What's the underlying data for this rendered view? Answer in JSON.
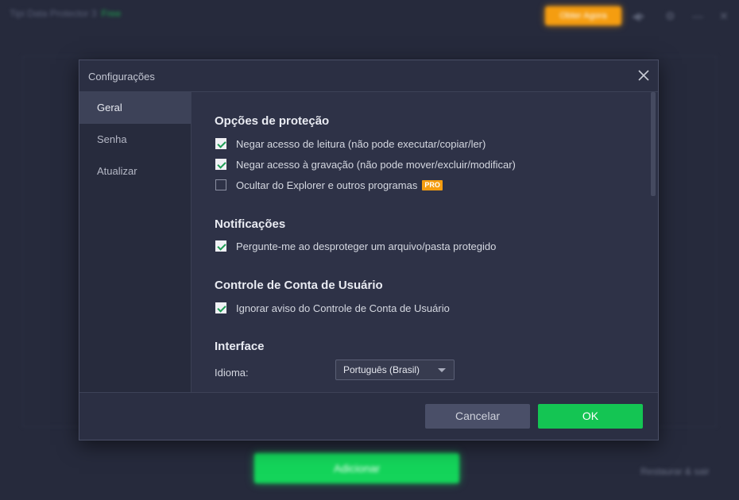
{
  "background_app": {
    "title": "Tipi Data Protector 3",
    "edition": "Free",
    "upgrade_label": "Obter Agora",
    "add_label": "Adicionar",
    "restore_label": "Restaurar & sair"
  },
  "dialog": {
    "title": "Configurações",
    "close_icon": "close-icon"
  },
  "sidebar": {
    "items": [
      {
        "label": "Geral",
        "active": true
      },
      {
        "label": "Senha",
        "active": false
      },
      {
        "label": "Atualizar",
        "active": false
      }
    ]
  },
  "protection": {
    "title": "Opções de proteção",
    "options": [
      {
        "label": "Negar acesso de leitura (não pode executar/copiar/ler)",
        "checked": true
      },
      {
        "label": "Negar acesso à gravação (não pode mover/excluir/modificar)",
        "checked": true
      },
      {
        "label": "Ocultar do Explorer e outros programas",
        "checked": false,
        "badge": "PRO"
      }
    ]
  },
  "notifications": {
    "title": "Notificações",
    "options": [
      {
        "label": "Pergunte-me ao desproteger um arquivo/pasta protegido",
        "checked": true
      }
    ]
  },
  "uac": {
    "title": "Controle de Conta de Usuário",
    "options": [
      {
        "label": "Ignorar aviso do Controle de Conta de Usuário",
        "checked": true
      }
    ]
  },
  "interface": {
    "title": "Interface",
    "language_label": "Idioma:",
    "language_value": "Português (Brasil)"
  },
  "footer": {
    "cancel_label": "Cancelar",
    "ok_label": "OK"
  },
  "colors": {
    "accent_green": "#14c553",
    "pro_orange": "#f59d10",
    "dialog_bg": "#2b2f43"
  }
}
